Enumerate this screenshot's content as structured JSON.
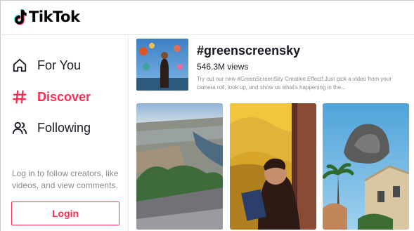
{
  "app": {
    "logo_text": "TikTok"
  },
  "sidebar": {
    "items": [
      {
        "label": "For You",
        "icon": "home-icon",
        "active": false
      },
      {
        "label": "Discover",
        "icon": "hashtag-icon",
        "active": true
      },
      {
        "label": "Following",
        "icon": "users-icon",
        "active": false
      }
    ],
    "login_hint": "Log in to follow creators, like videos, and view comments.",
    "login_label": "Login"
  },
  "hashtag": {
    "title": "#greenscreensky",
    "views": "546.3M views",
    "description": "Try out our new #GreenScreenSky Creative Effect! Just pick a video from your camera roll, look up, and show us what's happening in the..."
  },
  "colors": {
    "accent": "#fe2c55",
    "text": "#161823",
    "muted": "#8a8b91"
  },
  "videos": [
    {
      "icon": "city-aerial-thumbnail"
    },
    {
      "icon": "sunflower-sky-thumbnail"
    },
    {
      "icon": "palm-sky-thumbnail"
    }
  ]
}
